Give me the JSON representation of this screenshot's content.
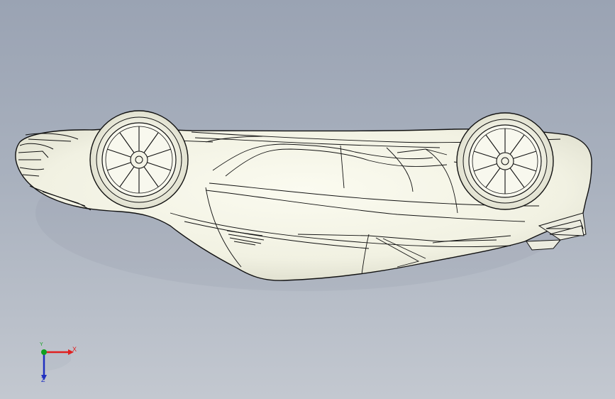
{
  "viewport": {
    "background_top": "#9aa3b3",
    "background_bottom": "#c3c8d0",
    "model_fill": "#f4f4e6",
    "model_edge": "#111111"
  },
  "triad": {
    "x_label": "X",
    "y_label": "Y",
    "z_label": "Z",
    "x_color": "#e02020",
    "y_color": "#10a020",
    "z_color": "#2030c0"
  }
}
